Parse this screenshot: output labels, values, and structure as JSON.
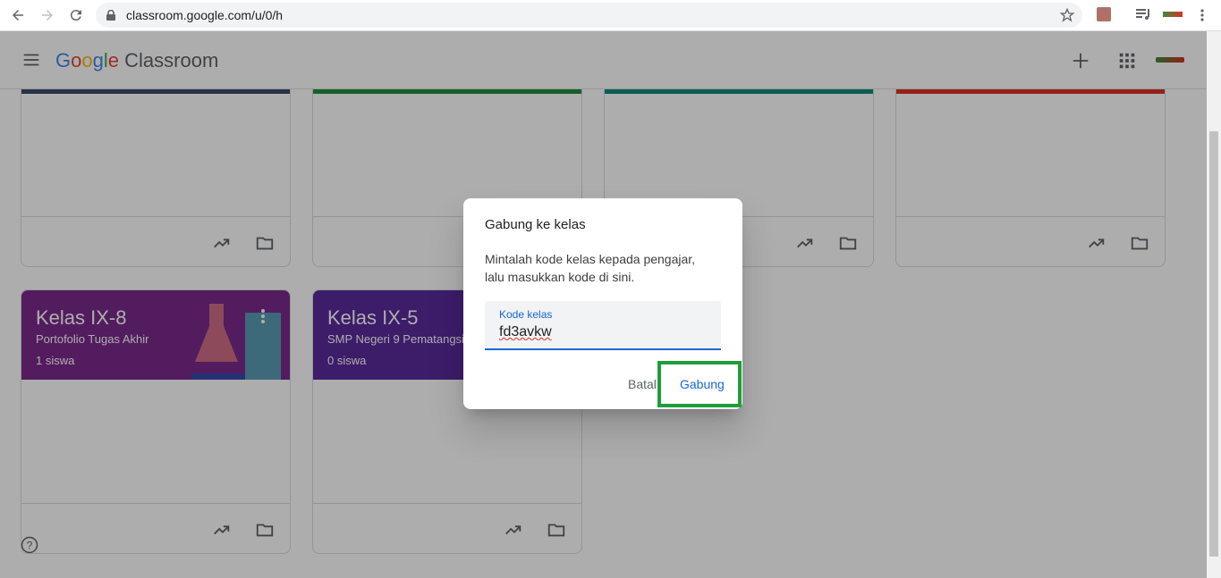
{
  "browser": {
    "url": "classroom.google.com/u/0/h"
  },
  "appbar": {
    "logo_google": "Google",
    "logo_product": "Classroom"
  },
  "cards": [
    {
      "title": "Kelas IX-8",
      "subtitle": "Portofolio Tugas Akhir",
      "count": "1 siswa",
      "color": "#7b2a8c"
    },
    {
      "title": "Kelas IX-5",
      "subtitle": "SMP Negeri 9 Pematangsiantar",
      "count": "0 siswa",
      "color": "#5a2a9c"
    }
  ],
  "top_card_colors": [
    "#3b4a6b",
    "#1e8e3e",
    "#0f8a7e",
    "#d93025"
  ],
  "dialog": {
    "title": "Gabung ke kelas",
    "text": "Mintalah kode kelas kepada pengajar, lalu masukkan kode di sini.",
    "field_label": "Kode kelas",
    "field_value": "fd3avkw",
    "cancel_label": "Batal",
    "join_label": "Gabung"
  },
  "colors": {
    "accent": "#1967d2",
    "highlight": "#1e9e3a"
  }
}
